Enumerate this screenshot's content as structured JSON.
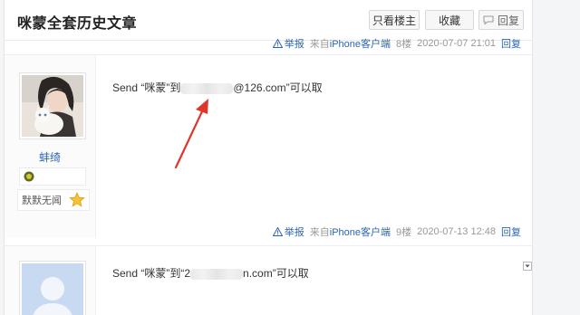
{
  "thread": {
    "title": "咪蒙全套历史文章"
  },
  "header": {
    "only_owner_label": "只看楼主",
    "collect_label": "收藏",
    "reply_label": "回复"
  },
  "floors": [
    {
      "report_label": "举报",
      "source_prefix": "来自",
      "source_app": "iPhone客户端",
      "floor": "8楼",
      "time": "2020-07-07 21:01",
      "reply_link": "回复"
    },
    {
      "username": "蚌绮",
      "title_badge": "默默无闻",
      "text_before": "Send “咪蒙”到",
      "text_after": "@126.com”可以取",
      "report_label": "举报",
      "source_prefix": "来自",
      "source_app": "iPhone客户端",
      "floor": "9楼",
      "time": "2020-07-13 12:48",
      "reply_link": "回复"
    },
    {
      "text_before": "Send “咪蒙”到“2",
      "text_after": "n.com”可以取"
    }
  ],
  "colors": {
    "link": "#2d64b3",
    "arrow": "#e0352b"
  },
  "icons": [
    "reply-icon",
    "warning-icon",
    "level-icon",
    "star-icon",
    "collapse-icon"
  ]
}
